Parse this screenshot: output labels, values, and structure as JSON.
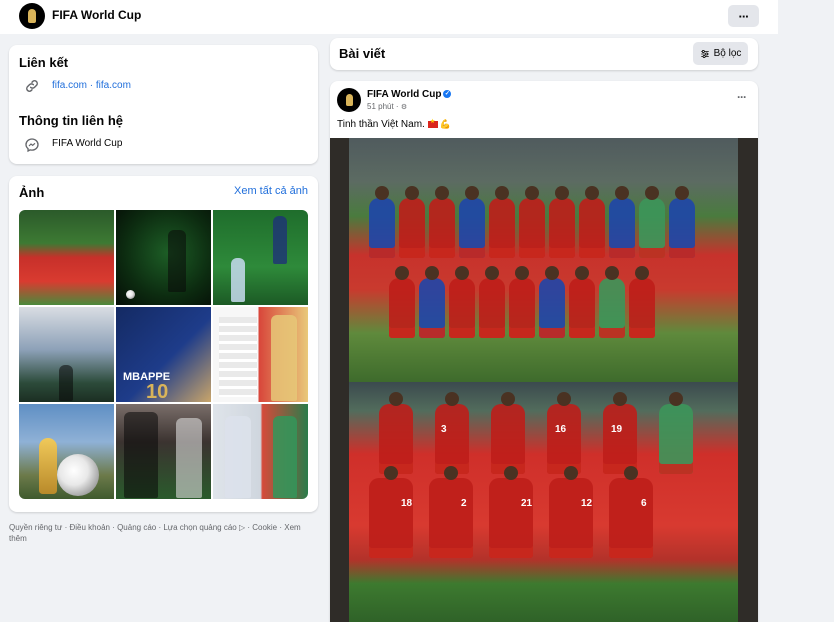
{
  "topbar": {
    "page_name": "FIFA World Cup",
    "more_label": "···"
  },
  "links_card": {
    "title": "Liên kết",
    "link_text": "fifa.com · fifa.com",
    "contact_title": "Thông tin liên hệ",
    "messenger_name": "FIFA World Cup"
  },
  "photos_card": {
    "title": "Ảnh",
    "see_all": "Xem tất cả ảnh",
    "tile_texts": {
      "mbappe": "MBAPPE",
      "mbappe_number": "10"
    }
  },
  "footer": {
    "text": "Quyền riêng tư · Điều khoản · Quảng cáo · Lựa chọn quảng cáo ▷ · Cookie · Xem thêm"
  },
  "posts": {
    "title": "Bài viết",
    "filter_label": "Bộ lọc"
  },
  "post": {
    "author": "FIFA World Cup",
    "time": "51 phút ·",
    "text": "Tinh thần Việt Nam.",
    "more_label": "···",
    "jersey_numbers": [
      "3",
      "16",
      "19",
      "18",
      "2",
      "21",
      "12",
      "6"
    ]
  },
  "colors": {
    "link": "#216fdb",
    "background": "#f0f2f5",
    "card": "#ffffff",
    "vietnam_red": "#da251d"
  }
}
